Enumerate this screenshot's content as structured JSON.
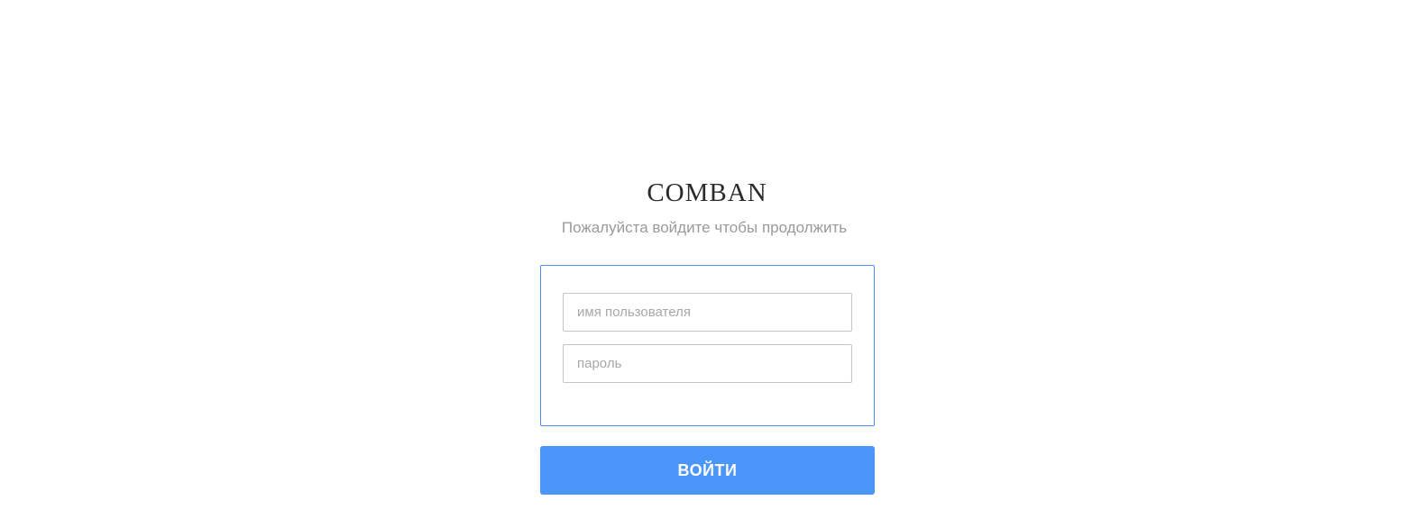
{
  "brand": {
    "name": "COMBAN"
  },
  "login": {
    "subtitle": "Пожалуйста войдите чтобы продолжить",
    "username_placeholder": "имя пользователя",
    "username_value": "",
    "password_placeholder": "пароль",
    "password_value": "",
    "submit_label": "ВОЙТИ"
  },
  "colors": {
    "accent": "#4a96fb",
    "form_border": "#4a90e2",
    "subtitle_text": "#9a9a9a",
    "brand_text": "#2b2b2b"
  }
}
